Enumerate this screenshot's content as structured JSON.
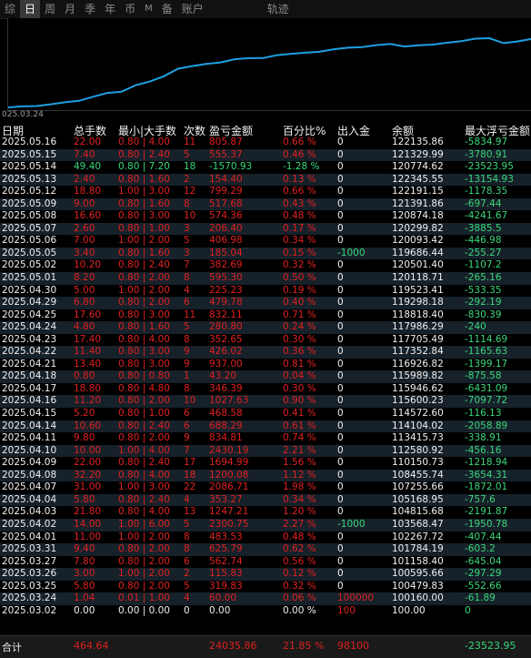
{
  "tabs": [
    "综",
    "日",
    "周",
    "月",
    "季",
    "年",
    "币",
    "M",
    "备",
    "账户",
    "轨迹"
  ],
  "chart": {
    "start_date": "025.03.24",
    "line_color": "#1e9fe0",
    "balance_series": [
      100160.0,
      100479.83,
      100595.66,
      101158.4,
      101784.19,
      102267.72,
      103568.47,
      104815.68,
      105168.95,
      107255.66,
      108455.74,
      110150.73,
      112580.92,
      113415.73,
      114104.02,
      114572.6,
      115600.23,
      115946.62,
      115989.82,
      116926.82,
      117352.84,
      117705.49,
      117986.29,
      118818.4,
      119298.18,
      119523.41,
      120118.71,
      120501.4,
      119686.44,
      120093.42,
      120299.82,
      120874.18,
      121391.86,
      122191.15,
      122345.55,
      120774.62,
      121329.99,
      122135.86
    ]
  },
  "header": {
    "date": "日期",
    "hands": "总手数",
    "minmax": "最小|大手数",
    "count": "次数",
    "pnl": "盈亏金额",
    "pct": "百分比%",
    "io": "出入金",
    "bal": "余额",
    "dd": "最大浮亏金额"
  },
  "rows": [
    {
      "date": "2025.05.16",
      "hands": "22.00",
      "minmax": "0.80 | 4.00",
      "count": "11",
      "pnl": "805.87",
      "pct": "0.66 %",
      "io": "0",
      "bal": "122135.86",
      "dd": "-5834.97",
      "color": "red"
    },
    {
      "date": "2025.05.15",
      "hands": "7.40",
      "minmax": "0.80 | 2.40",
      "count": "5",
      "pnl": "555.37",
      "pct": "0.46 %",
      "io": "0",
      "bal": "121329.99",
      "dd": "-3780.91",
      "color": "red"
    },
    {
      "date": "2025.05.14",
      "hands": "49.40",
      "minmax": "0.80 | 7.20",
      "count": "18",
      "pnl": "-1570.93",
      "pct": "-1.28 %",
      "io": "0",
      "bal": "120774.62",
      "dd": "-23523.95",
      "color": "green"
    },
    {
      "date": "2025.05.13",
      "hands": "2.40",
      "minmax": "0.80 | 1.60",
      "count": "2",
      "pnl": "154.40",
      "pct": "0.13 %",
      "io": "0",
      "bal": "122345.55",
      "dd": "-13154.93",
      "color": "red"
    },
    {
      "date": "2025.05.12",
      "hands": "18.80",
      "minmax": "1.00 | 3.00",
      "count": "12",
      "pnl": "799.29",
      "pct": "0.66 %",
      "io": "0",
      "bal": "122191.15",
      "dd": "-1178.35",
      "color": "red"
    },
    {
      "date": "2025.05.09",
      "hands": "9.00",
      "minmax": "0.80 | 1.60",
      "count": "8",
      "pnl": "517.68",
      "pct": "0.43 %",
      "io": "0",
      "bal": "121391.86",
      "dd": "-697.44",
      "color": "red"
    },
    {
      "date": "2025.05.08",
      "hands": "16.60",
      "minmax": "0.80 | 3.00",
      "count": "10",
      "pnl": "574.36",
      "pct": "0.48 %",
      "io": "0",
      "bal": "120874.18",
      "dd": "-4241.67",
      "color": "red"
    },
    {
      "date": "2025.05.07",
      "hands": "2.60",
      "minmax": "0.80 | 1.00",
      "count": "3",
      "pnl": "206.40",
      "pct": "0.17 %",
      "io": "0",
      "bal": "120299.82",
      "dd": "-3885.5",
      "color": "red"
    },
    {
      "date": "2025.05.06",
      "hands": "7.00",
      "minmax": "1.00 | 2.00",
      "count": "5",
      "pnl": "406.98",
      "pct": "0.34 %",
      "io": "0",
      "bal": "120093.42",
      "dd": "-446.98",
      "color": "red"
    },
    {
      "date": "2025.05.05",
      "hands": "3.40",
      "minmax": "0.80 | 1.60",
      "count": "3",
      "pnl": "185.04",
      "pct": "0.15 %",
      "io": "-1000",
      "bal": "119686.44",
      "dd": "-255.27",
      "color": "red"
    },
    {
      "date": "2025.05.02",
      "hands": "10.20",
      "minmax": "0.80 | 2.40",
      "count": "7",
      "pnl": "382.69",
      "pct": "0.32 %",
      "io": "0",
      "bal": "120501.40",
      "dd": "-1107.2",
      "color": "red"
    },
    {
      "date": "2025.05.01",
      "hands": "8.20",
      "minmax": "0.80 | 2.00",
      "count": "8",
      "pnl": "595.30",
      "pct": "0.50 %",
      "io": "0",
      "bal": "120118.71",
      "dd": "-265.16",
      "color": "red"
    },
    {
      "date": "2025.04.30",
      "hands": "5.00",
      "minmax": "1.00 | 2.00",
      "count": "4",
      "pnl": "225.23",
      "pct": "0.19 %",
      "io": "0",
      "bal": "119523.41",
      "dd": "-533.35",
      "color": "red"
    },
    {
      "date": "2025.04.29",
      "hands": "6.80",
      "minmax": "0.80 | 2.00",
      "count": "6",
      "pnl": "479.78",
      "pct": "0.40 %",
      "io": "0",
      "bal": "119298.18",
      "dd": "-292.19",
      "color": "red"
    },
    {
      "date": "2025.04.25",
      "hands": "17.60",
      "minmax": "0.80 | 3.00",
      "count": "11",
      "pnl": "832.11",
      "pct": "0.71 %",
      "io": "0",
      "bal": "118818.40",
      "dd": "-830.39",
      "color": "red"
    },
    {
      "date": "2025.04.24",
      "hands": "4.80",
      "minmax": "0.80 | 1.60",
      "count": "5",
      "pnl": "280.80",
      "pct": "0.24 %",
      "io": "0",
      "bal": "117986.29",
      "dd": "-240",
      "color": "red"
    },
    {
      "date": "2025.04.23",
      "hands": "17.40",
      "minmax": "0.80 | 4.00",
      "count": "8",
      "pnl": "352.65",
      "pct": "0.30 %",
      "io": "0",
      "bal": "117705.49",
      "dd": "-1114.69",
      "color": "red"
    },
    {
      "date": "2025.04.22",
      "hands": "11.40",
      "minmax": "0.80 | 3.00",
      "count": "9",
      "pnl": "426.02",
      "pct": "0.36 %",
      "io": "0",
      "bal": "117352.84",
      "dd": "-1165.63",
      "color": "red"
    },
    {
      "date": "2025.04.21",
      "hands": "13.40",
      "minmax": "0.80 | 3.00",
      "count": "9",
      "pnl": "937.00",
      "pct": "0.81 %",
      "io": "0",
      "bal": "116926.82",
      "dd": "-1399.17",
      "color": "red"
    },
    {
      "date": "2025.04.18",
      "hands": "0.80",
      "minmax": "0.80 | 0.80",
      "count": "1",
      "pnl": "43.20",
      "pct": "0.04 %",
      "io": "0",
      "bal": "115989.82",
      "dd": "-875.58",
      "color": "red"
    },
    {
      "date": "2025.04.17",
      "hands": "18.80",
      "minmax": "0.80 | 4.80",
      "count": "8",
      "pnl": "346.39",
      "pct": "0.30 %",
      "io": "0",
      "bal": "115946.62",
      "dd": "-6431.09",
      "color": "red"
    },
    {
      "date": "2025.04.16",
      "hands": "11.20",
      "minmax": "0.80 | 2.00",
      "count": "10",
      "pnl": "1027.63",
      "pct": "0.90 %",
      "io": "0",
      "bal": "115600.23",
      "dd": "-7097.72",
      "color": "red"
    },
    {
      "date": "2025.04.15",
      "hands": "5.20",
      "minmax": "0.80 | 1.00",
      "count": "6",
      "pnl": "468.58",
      "pct": "0.41 %",
      "io": "0",
      "bal": "114572.60",
      "dd": "-116.13",
      "color": "red"
    },
    {
      "date": "2025.04.14",
      "hands": "10.60",
      "minmax": "0.80 | 2.40",
      "count": "6",
      "pnl": "688.29",
      "pct": "0.61 %",
      "io": "0",
      "bal": "114104.02",
      "dd": "-2058.89",
      "color": "red"
    },
    {
      "date": "2025.04.11",
      "hands": "9.80",
      "minmax": "0.80 | 2.00",
      "count": "9",
      "pnl": "834.81",
      "pct": "0.74 %",
      "io": "0",
      "bal": "113415.73",
      "dd": "-338.91",
      "color": "red"
    },
    {
      "date": "2025.04.10",
      "hands": "10.00",
      "minmax": "1.00 | 4.00",
      "count": "7",
      "pnl": "2430.19",
      "pct": "2.21 %",
      "io": "0",
      "bal": "112580.92",
      "dd": "-456.16",
      "color": "red"
    },
    {
      "date": "2025.04.09",
      "hands": "22.00",
      "minmax": "0.80 | 2.40",
      "count": "17",
      "pnl": "1694.99",
      "pct": "1.56 %",
      "io": "0",
      "bal": "110150.73",
      "dd": "-1218.94",
      "color": "red"
    },
    {
      "date": "2025.04.08",
      "hands": "32.20",
      "minmax": "0.80 | 4.00",
      "count": "18",
      "pnl": "1200.08",
      "pct": "1.12 %",
      "io": "0",
      "bal": "108455.74",
      "dd": "-3654.31",
      "color": "red"
    },
    {
      "date": "2025.04.07",
      "hands": "31.00",
      "minmax": "1.00 | 3.00",
      "count": "22",
      "pnl": "2086.71",
      "pct": "1.98 %",
      "io": "0",
      "bal": "107255.66",
      "dd": "-1872.01",
      "color": "red"
    },
    {
      "date": "2025.04.04",
      "hands": "5.80",
      "minmax": "0.80 | 2.40",
      "count": "4",
      "pnl": "353.27",
      "pct": "0.34 %",
      "io": "0",
      "bal": "105168.95",
      "dd": "-757.6",
      "color": "red"
    },
    {
      "date": "2025.04.03",
      "hands": "21.80",
      "minmax": "0.80 | 4.00",
      "count": "13",
      "pnl": "1247.21",
      "pct": "1.20 %",
      "io": "0",
      "bal": "104815.68",
      "dd": "-2191.87",
      "color": "red"
    },
    {
      "date": "2025.04.02",
      "hands": "14.00",
      "minmax": "1.00 | 6.00",
      "count": "5",
      "pnl": "2300.75",
      "pct": "2.27 %",
      "io": "-1000",
      "bal": "103568.47",
      "dd": "-1950.78",
      "color": "red"
    },
    {
      "date": "2025.04.01",
      "hands": "11.00",
      "minmax": "1.00 | 2.00",
      "count": "8",
      "pnl": "483.53",
      "pct": "0.48 %",
      "io": "0",
      "bal": "102267.72",
      "dd": "-407.44",
      "color": "red"
    },
    {
      "date": "2025.03.31",
      "hands": "9.40",
      "minmax": "0.80 | 2.00",
      "count": "8",
      "pnl": "625.79",
      "pct": "0.62 %",
      "io": "0",
      "bal": "101784.19",
      "dd": "-603.2",
      "color": "red"
    },
    {
      "date": "2025.03.27",
      "hands": "7.80",
      "minmax": "0.80 | 2.00",
      "count": "6",
      "pnl": "562.74",
      "pct": "0.56 %",
      "io": "0",
      "bal": "101158.40",
      "dd": "-645.04",
      "color": "red"
    },
    {
      "date": "2025.03.26",
      "hands": "3.00",
      "minmax": "1.00 | 2.00",
      "count": "2",
      "pnl": "115.83",
      "pct": "0.12 %",
      "io": "0",
      "bal": "100595.66",
      "dd": "-297.29",
      "color": "red"
    },
    {
      "date": "2025.03.25",
      "hands": "5.80",
      "minmax": "0.80 | 2.00",
      "count": "5",
      "pnl": "319.83",
      "pct": "0.32 %",
      "io": "0",
      "bal": "100479.83",
      "dd": "-552.66",
      "color": "red"
    },
    {
      "date": "2025.03.24",
      "hands": "1.04",
      "minmax": "0.01 | 1.00",
      "count": "4",
      "pnl": "60.00",
      "pct": "0.06 %",
      "io": "100000",
      "bal": "100160.00",
      "dd": "-61.89",
      "color": "red"
    },
    {
      "date": "2025.03.02",
      "hands": "0.00",
      "minmax": "0.00 | 0.00",
      "count": "0",
      "pnl": "0.00",
      "pct": "0.00 %",
      "io": "100",
      "bal": "100.00",
      "dd": "0",
      "color": "white"
    }
  ],
  "total": {
    "label": "合计",
    "hands": "464.64",
    "pnl": "24035.86",
    "pct": "21.85 %",
    "io": "98100",
    "dd": "-23523.95"
  }
}
